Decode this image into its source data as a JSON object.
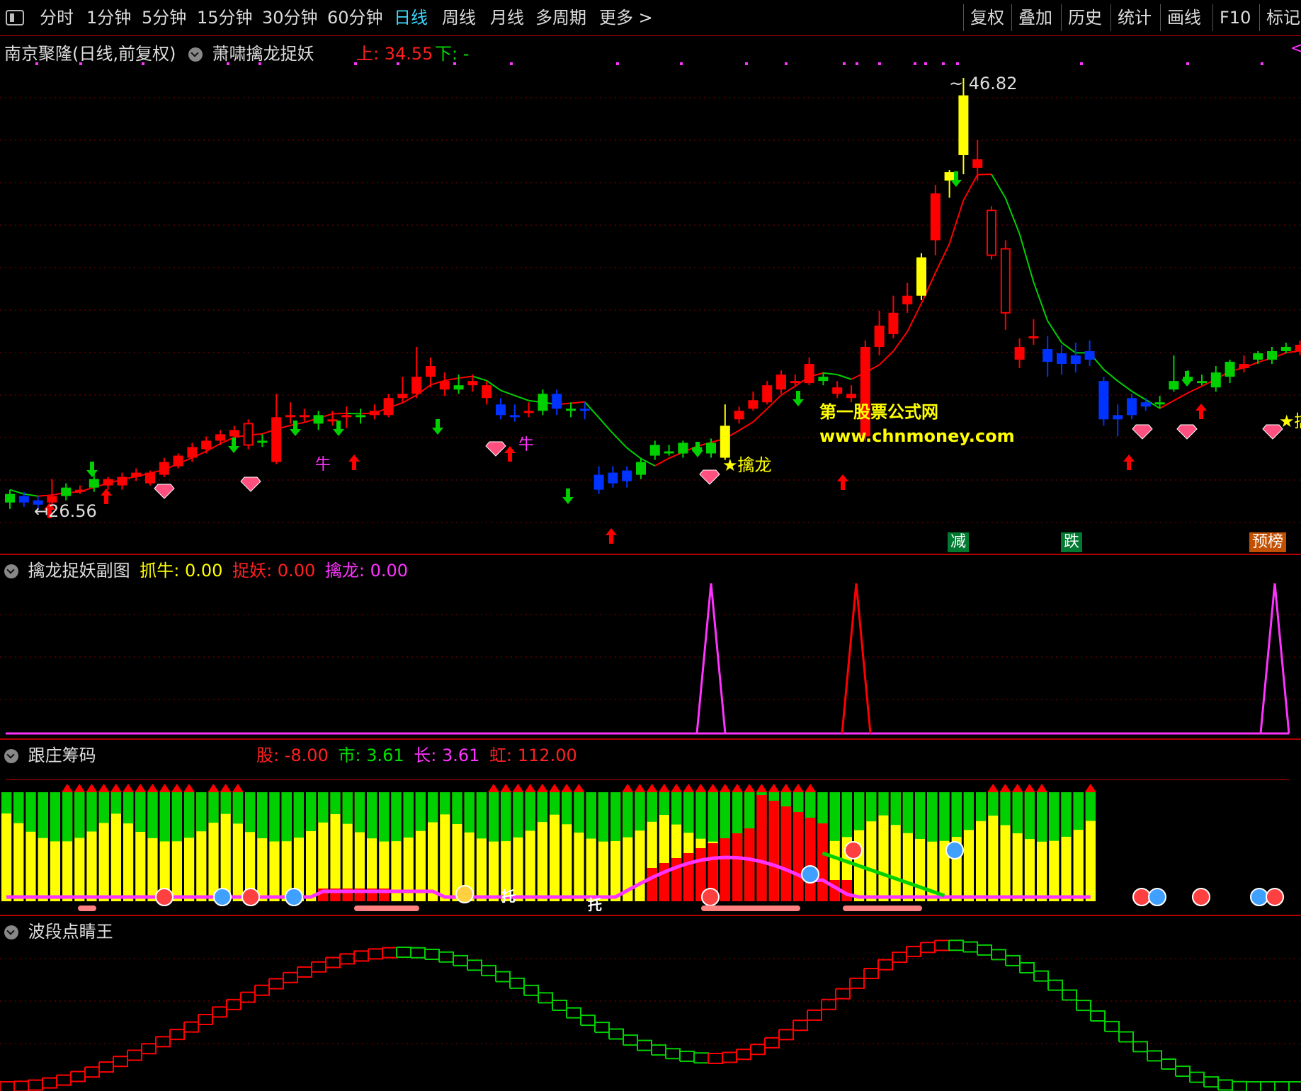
{
  "toolbar": {
    "left_items": [
      {
        "label": "分时"
      },
      {
        "label": "1分钟"
      },
      {
        "label": "5分钟"
      },
      {
        "label": "15分钟"
      },
      {
        "label": "30分钟"
      },
      {
        "label": "60分钟"
      },
      {
        "label": "日线",
        "active": true
      },
      {
        "label": "周线"
      },
      {
        "label": "月线"
      },
      {
        "label": "多周期"
      },
      {
        "label": "更多 >"
      }
    ],
    "right_items": [
      {
        "label": "复权"
      },
      {
        "label": "叠加"
      },
      {
        "label": "历史"
      },
      {
        "label": "统计"
      },
      {
        "label": "画线"
      },
      {
        "label": "F10"
      },
      {
        "label": "标记"
      }
    ]
  },
  "main_panel": {
    "stock_title": "南京聚隆(日线,前复权)",
    "indicator_name": "萧啸擒龙捉妖",
    "up_label": "上: 34.55",
    "down_label": "下: -",
    "high_price": "46.82",
    "low_price": "26.56",
    "signal_qinlong": "擒龙",
    "signal_niu": "牛",
    "signal_jian": "减",
    "signal_die": "跌",
    "signal_yujing": "预榜",
    "signal_qin_partial": "擒",
    "watermark_name": "第一股票公式网",
    "watermark_url": "www.chnmoney.com"
  },
  "sub1": {
    "title": "擒龙捉妖副图",
    "zhuaniu": "抓牛: 0.00",
    "zhuoyao": "捉妖: 0.00",
    "qinlong": "擒龙: 0.00"
  },
  "sub2": {
    "title": "跟庄筹码",
    "gu": "股: -8.00",
    "shi": "市: 3.61",
    "chang": "长: 3.61",
    "hong": "虹: 112.00",
    "tuo": "托"
  },
  "sub3": {
    "title": "波段点睛王"
  },
  "colors": {
    "up": "#ff0000",
    "down": "#00d000",
    "blue": "#0033ff",
    "yellow": "#ffff00",
    "magenta": "#ff33ff",
    "grid": "#8a0000"
  },
  "chart_data": {
    "type": "candlestick",
    "high_label": 46.82,
    "low_label": 26.56,
    "candles": [
      {
        "o": 26.9,
        "c": 27.3,
        "h": 27.5,
        "l": 26.6,
        "k": "g"
      },
      {
        "o": 27.2,
        "c": 26.9,
        "h": 27.4,
        "l": 26.7,
        "k": "b"
      },
      {
        "o": 27.0,
        "c": 26.8,
        "h": 27.2,
        "l": 26.56,
        "k": "b"
      },
      {
        "o": 26.9,
        "c": 27.2,
        "h": 28.0,
        "l": 26.7,
        "k": "r"
      },
      {
        "o": 27.2,
        "c": 27.6,
        "h": 27.8,
        "l": 27.0,
        "k": "g"
      },
      {
        "o": 27.5,
        "c": 27.5,
        "h": 27.7,
        "l": 27.3,
        "k": "r"
      },
      {
        "o": 27.6,
        "c": 28.0,
        "h": 28.3,
        "l": 27.4,
        "k": "g"
      },
      {
        "o": 28.0,
        "c": 27.7,
        "h": 28.1,
        "l": 27.5,
        "k": "r"
      },
      {
        "o": 27.7,
        "c": 28.1,
        "h": 28.3,
        "l": 27.5,
        "k": "r"
      },
      {
        "o": 28.1,
        "c": 28.3,
        "h": 28.5,
        "l": 27.9,
        "k": "r"
      },
      {
        "o": 27.8,
        "c": 28.3,
        "h": 28.4,
        "l": 27.7,
        "k": "r"
      },
      {
        "o": 28.2,
        "c": 28.8,
        "h": 29.0,
        "l": 28.1,
        "k": "r"
      },
      {
        "o": 28.6,
        "c": 29.1,
        "h": 29.2,
        "l": 28.5,
        "k": "r"
      },
      {
        "o": 29.0,
        "c": 29.5,
        "h": 29.7,
        "l": 28.8,
        "k": "r"
      },
      {
        "o": 29.4,
        "c": 29.8,
        "h": 30.0,
        "l": 29.2,
        "k": "r"
      },
      {
        "o": 29.8,
        "c": 30.1,
        "h": 30.3,
        "l": 29.6,
        "k": "r"
      },
      {
        "o": 30.0,
        "c": 30.3,
        "h": 30.5,
        "l": 29.9,
        "k": "r"
      },
      {
        "o": 30.6,
        "c": 29.6,
        "h": 30.8,
        "l": 29.4,
        "k": "w"
      },
      {
        "o": 29.8,
        "c": 29.8,
        "h": 30.1,
        "l": 29.5,
        "k": "g"
      },
      {
        "o": 28.8,
        "c": 30.9,
        "h": 32.0,
        "l": 28.7,
        "k": "r"
      },
      {
        "o": 31.0,
        "c": 31.0,
        "h": 31.6,
        "l": 30.6,
        "k": "r"
      },
      {
        "o": 31.0,
        "c": 31.0,
        "h": 31.3,
        "l": 30.7,
        "k": "r"
      },
      {
        "o": 31.0,
        "c": 30.6,
        "h": 31.2,
        "l": 30.3,
        "k": "g"
      },
      {
        "o": 30.8,
        "c": 30.8,
        "h": 31.2,
        "l": 30.5,
        "k": "r"
      },
      {
        "o": 30.9,
        "c": 31.0,
        "h": 31.4,
        "l": 30.4,
        "k": "r"
      },
      {
        "o": 31.0,
        "c": 30.9,
        "h": 31.3,
        "l": 30.6,
        "k": "g"
      },
      {
        "o": 31.0,
        "c": 31.2,
        "h": 31.5,
        "l": 30.8,
        "k": "r"
      },
      {
        "o": 31.0,
        "c": 31.8,
        "h": 32.0,
        "l": 30.9,
        "k": "r"
      },
      {
        "o": 31.8,
        "c": 32.0,
        "h": 32.8,
        "l": 31.6,
        "k": "r"
      },
      {
        "o": 32.0,
        "c": 32.8,
        "h": 34.2,
        "l": 31.8,
        "k": "r"
      },
      {
        "o": 32.8,
        "c": 33.3,
        "h": 33.7,
        "l": 32.3,
        "k": "r"
      },
      {
        "o": 32.6,
        "c": 32.2,
        "h": 33.0,
        "l": 31.9,
        "k": "r"
      },
      {
        "o": 32.2,
        "c": 32.4,
        "h": 32.9,
        "l": 32.0,
        "k": "g"
      },
      {
        "o": 32.6,
        "c": 32.4,
        "h": 32.9,
        "l": 32.1,
        "k": "r"
      },
      {
        "o": 32.4,
        "c": 31.8,
        "h": 32.6,
        "l": 31.5,
        "k": "r"
      },
      {
        "o": 31.5,
        "c": 31.0,
        "h": 31.8,
        "l": 30.8,
        "k": "b"
      },
      {
        "o": 31.0,
        "c": 31.0,
        "h": 31.5,
        "l": 30.7,
        "k": "b"
      },
      {
        "o": 31.2,
        "c": 31.2,
        "h": 31.6,
        "l": 30.9,
        "k": "r"
      },
      {
        "o": 31.2,
        "c": 32.0,
        "h": 32.2,
        "l": 31.0,
        "k": "g"
      },
      {
        "o": 32.0,
        "c": 31.3,
        "h": 32.2,
        "l": 31.0,
        "k": "b"
      },
      {
        "o": 31.3,
        "c": 31.3,
        "h": 31.6,
        "l": 30.9,
        "k": "g"
      },
      {
        "o": 31.3,
        "c": 31.3,
        "h": 31.6,
        "l": 30.8,
        "k": "b"
      },
      {
        "o": 28.2,
        "c": 27.5,
        "h": 28.6,
        "l": 27.3,
        "k": "b"
      },
      {
        "o": 27.8,
        "c": 28.3,
        "h": 28.6,
        "l": 27.6,
        "k": "b"
      },
      {
        "o": 28.4,
        "c": 27.9,
        "h": 28.6,
        "l": 27.6,
        "k": "b"
      },
      {
        "o": 28.2,
        "c": 28.8,
        "h": 29.0,
        "l": 28.0,
        "k": "g"
      },
      {
        "o": 29.1,
        "c": 29.6,
        "h": 29.8,
        "l": 28.9,
        "k": "g"
      },
      {
        "o": 29.3,
        "c": 29.3,
        "h": 29.6,
        "l": 29.1,
        "k": "g"
      },
      {
        "o": 29.2,
        "c": 29.7,
        "h": 29.8,
        "l": 29.0,
        "k": "g"
      },
      {
        "o": 29.5,
        "c": 29.3,
        "h": 29.7,
        "l": 29.1,
        "k": "g"
      },
      {
        "o": 29.2,
        "c": 29.7,
        "h": 29.9,
        "l": 29.0,
        "k": "g"
      },
      {
        "o": 29.0,
        "c": 30.5,
        "h": 31.5,
        "l": 28.9,
        "k": "y"
      },
      {
        "o": 30.8,
        "c": 31.2,
        "h": 31.4,
        "l": 30.6,
        "k": "r"
      },
      {
        "o": 31.3,
        "c": 31.7,
        "h": 32.1,
        "l": 31.2,
        "k": "r"
      },
      {
        "o": 31.6,
        "c": 32.4,
        "h": 32.6,
        "l": 31.5,
        "k": "r"
      },
      {
        "o": 32.2,
        "c": 32.9,
        "h": 33.1,
        "l": 32.0,
        "k": "r"
      },
      {
        "o": 32.5,
        "c": 32.6,
        "h": 32.9,
        "l": 32.3,
        "k": "r"
      },
      {
        "o": 32.5,
        "c": 33.4,
        "h": 33.7,
        "l": 32.4,
        "k": "r"
      },
      {
        "o": 32.8,
        "c": 32.6,
        "h": 33.0,
        "l": 32.4,
        "k": "g"
      },
      {
        "o": 32.3,
        "c": 32.0,
        "h": 32.6,
        "l": 31.8,
        "k": "r"
      },
      {
        "o": 32.0,
        "c": 31.8,
        "h": 32.4,
        "l": 31.6,
        "k": "r"
      },
      {
        "o": 30.0,
        "c": 34.2,
        "h": 34.5,
        "l": 29.8,
        "k": "r"
      },
      {
        "o": 34.2,
        "c": 35.2,
        "h": 35.9,
        "l": 33.8,
        "k": "r"
      },
      {
        "o": 34.8,
        "c": 35.8,
        "h": 36.6,
        "l": 34.6,
        "k": "r"
      },
      {
        "o": 36.2,
        "c": 36.6,
        "h": 37.2,
        "l": 35.8,
        "k": "r"
      },
      {
        "o": 36.6,
        "c": 38.4,
        "h": 38.6,
        "l": 36.4,
        "k": "y"
      },
      {
        "o": 39.2,
        "c": 41.4,
        "h": 41.8,
        "l": 38.5,
        "k": "r"
      },
      {
        "o": 42.4,
        "c": 42.0,
        "h": 42.5,
        "l": 41.2,
        "k": "y"
      },
      {
        "o": 43.2,
        "c": 46.0,
        "h": 46.82,
        "l": 42.3,
        "k": "y"
      },
      {
        "o": 43.0,
        "c": 42.6,
        "h": 43.9,
        "l": 42.0,
        "k": "r"
      },
      {
        "o": 40.6,
        "c": 38.5,
        "h": 40.8,
        "l": 38.3,
        "k": "w"
      },
      {
        "o": 38.8,
        "c": 35.8,
        "h": 39.2,
        "l": 35.0,
        "k": "w"
      },
      {
        "o": 34.2,
        "c": 33.6,
        "h": 34.6,
        "l": 33.2,
        "k": "r"
      },
      {
        "o": 34.7,
        "c": 34.7,
        "h": 35.5,
        "l": 34.3,
        "k": "r"
      },
      {
        "o": 34.1,
        "c": 33.5,
        "h": 34.7,
        "l": 32.8,
        "k": "b"
      },
      {
        "o": 33.9,
        "c": 33.4,
        "h": 34.3,
        "l": 32.9,
        "k": "b"
      },
      {
        "o": 33.8,
        "c": 33.4,
        "h": 34.4,
        "l": 33.0,
        "k": "b"
      },
      {
        "o": 34.0,
        "c": 33.6,
        "h": 34.5,
        "l": 33.3,
        "k": "b"
      },
      {
        "o": 32.6,
        "c": 30.8,
        "h": 32.8,
        "l": 30.5,
        "k": "b"
      },
      {
        "o": 31.0,
        "c": 30.8,
        "h": 31.5,
        "l": 30.0,
        "k": "b"
      },
      {
        "o": 31.8,
        "c": 31.0,
        "h": 32.0,
        "l": 30.8,
        "k": "b"
      },
      {
        "o": 31.6,
        "c": 31.4,
        "h": 31.8,
        "l": 31.2,
        "k": "b"
      },
      {
        "o": 31.6,
        "c": 31.6,
        "h": 31.9,
        "l": 31.3,
        "k": "g"
      },
      {
        "o": 32.2,
        "c": 32.6,
        "h": 33.8,
        "l": 32.1,
        "k": "g"
      },
      {
        "o": 32.8,
        "c": 32.6,
        "h": 33.1,
        "l": 32.5,
        "k": "g"
      },
      {
        "o": 32.6,
        "c": 32.6,
        "h": 32.9,
        "l": 32.4,
        "k": "g"
      },
      {
        "o": 32.3,
        "c": 33.0,
        "h": 33.3,
        "l": 32.1,
        "k": "g"
      },
      {
        "o": 32.8,
        "c": 33.5,
        "h": 33.6,
        "l": 32.5,
        "k": "g"
      },
      {
        "o": 33.2,
        "c": 33.4,
        "h": 33.8,
        "l": 33.0,
        "k": "r"
      },
      {
        "o": 33.6,
        "c": 33.9,
        "h": 34.0,
        "l": 33.4,
        "k": "g"
      },
      {
        "o": 34.0,
        "c": 33.6,
        "h": 34.2,
        "l": 33.4,
        "k": "g"
      },
      {
        "o": 34.0,
        "c": 34.2,
        "h": 34.4,
        "l": 33.9,
        "k": "g"
      },
      {
        "o": 34.3,
        "c": 34.0,
        "h": 34.5,
        "l": 33.8,
        "k": "r"
      },
      {
        "o": 34.5,
        "c": 32.4,
        "h": 34.9,
        "l": 32.2,
        "k": "y"
      },
      {
        "o": 33.0,
        "c": 34.8,
        "h": 36.2,
        "l": 32.6,
        "k": "r"
      }
    ]
  }
}
